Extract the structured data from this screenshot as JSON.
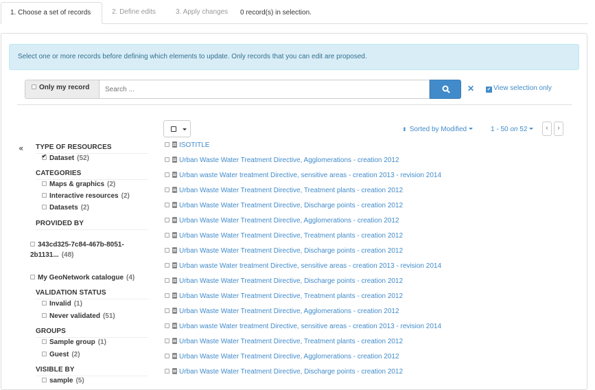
{
  "tabs": [
    {
      "label": "1. Choose a set of records"
    },
    {
      "label": "2. Define edits"
    },
    {
      "label": "3. Apply changes"
    }
  ],
  "selection_count": "0 record(s) in selection.",
  "alert_text": "Select one or more records before defining which elements to update. Only records that you can edit are proposed.",
  "search": {
    "only_my_label": "Only my record",
    "placeholder": "Search ...",
    "view_selection_label": "View selection only"
  },
  "sort_label": "Sorted by Modified",
  "pager": {
    "range": "1 - 50",
    "on": "on",
    "total": "52"
  },
  "facets": {
    "collapse_symbol": "«",
    "type_of_resources": {
      "title": "TYPE OF RESOURCES",
      "items": [
        {
          "label": "Dataset",
          "count": "(52)",
          "checked": true
        }
      ]
    },
    "categories": {
      "title": "CATEGORIES",
      "items": [
        {
          "label": "Maps & graphics",
          "count": "(2)"
        },
        {
          "label": "Interactive resources",
          "count": "(2)"
        },
        {
          "label": "Datasets",
          "count": "(2)"
        }
      ]
    },
    "provided_by": {
      "title": "PROVIDED BY",
      "items": [
        {
          "label": "343cd325-7c84-467b-8051-2b1131...",
          "count": "(48)"
        },
        {
          "label": "My GeoNetwork catalogue",
          "count": "(4)"
        }
      ]
    },
    "validation_status": {
      "title": "VALIDATION STATUS",
      "items": [
        {
          "label": "Invalid",
          "count": "(1)"
        },
        {
          "label": "Never validated",
          "count": "(51)"
        }
      ]
    },
    "groups": {
      "title": "GROUPS",
      "items": [
        {
          "label": "Sample group",
          "count": "(1)"
        },
        {
          "label": "Guest",
          "count": "(2)"
        }
      ]
    },
    "visible_by": {
      "title": "VISIBLE BY",
      "items": [
        {
          "label": "sample",
          "count": "(5)"
        }
      ]
    }
  },
  "results": [
    "ISOTITLE",
    "Urban Waste Water Treatment Directive, Agglomerations - creation 2012",
    "Urban waste Water treatment Directive, sensitive areas - creation 2013 - revision 2014",
    "Urban Waste Water Treatment Directive, Treatment plants - creation 2012",
    "Urban Waste Water Treatment Directive, Discharge points - creation 2012",
    "Urban Waste Water Treatment Directive, Agglomerations - creation 2012",
    "Urban Waste Water Treatment Directive, Treatment plants - creation 2012",
    "Urban Waste Water Treatment Directive, Discharge points - creation 2012",
    "Urban waste Water treatment Directive, sensitive areas - creation 2013 - revision 2014",
    "Urban Waste Water Treatment Directive, Discharge points - creation 2012",
    "Urban Waste Water Treatment Directive, Treatment plants - creation 2012",
    "Urban Waste Water Treatment Directive, Agglomerations - creation 2012",
    "Urban waste Water treatment Directive, sensitive areas - creation 2013 - revision 2014",
    "Urban Waste Water Treatment Directive, Treatment plants - creation 2012",
    "Urban Waste Water Treatment Directive, Agglomerations - creation 2012",
    "Urban Waste Water Treatment Directive, Discharge points - creation 2012"
  ]
}
